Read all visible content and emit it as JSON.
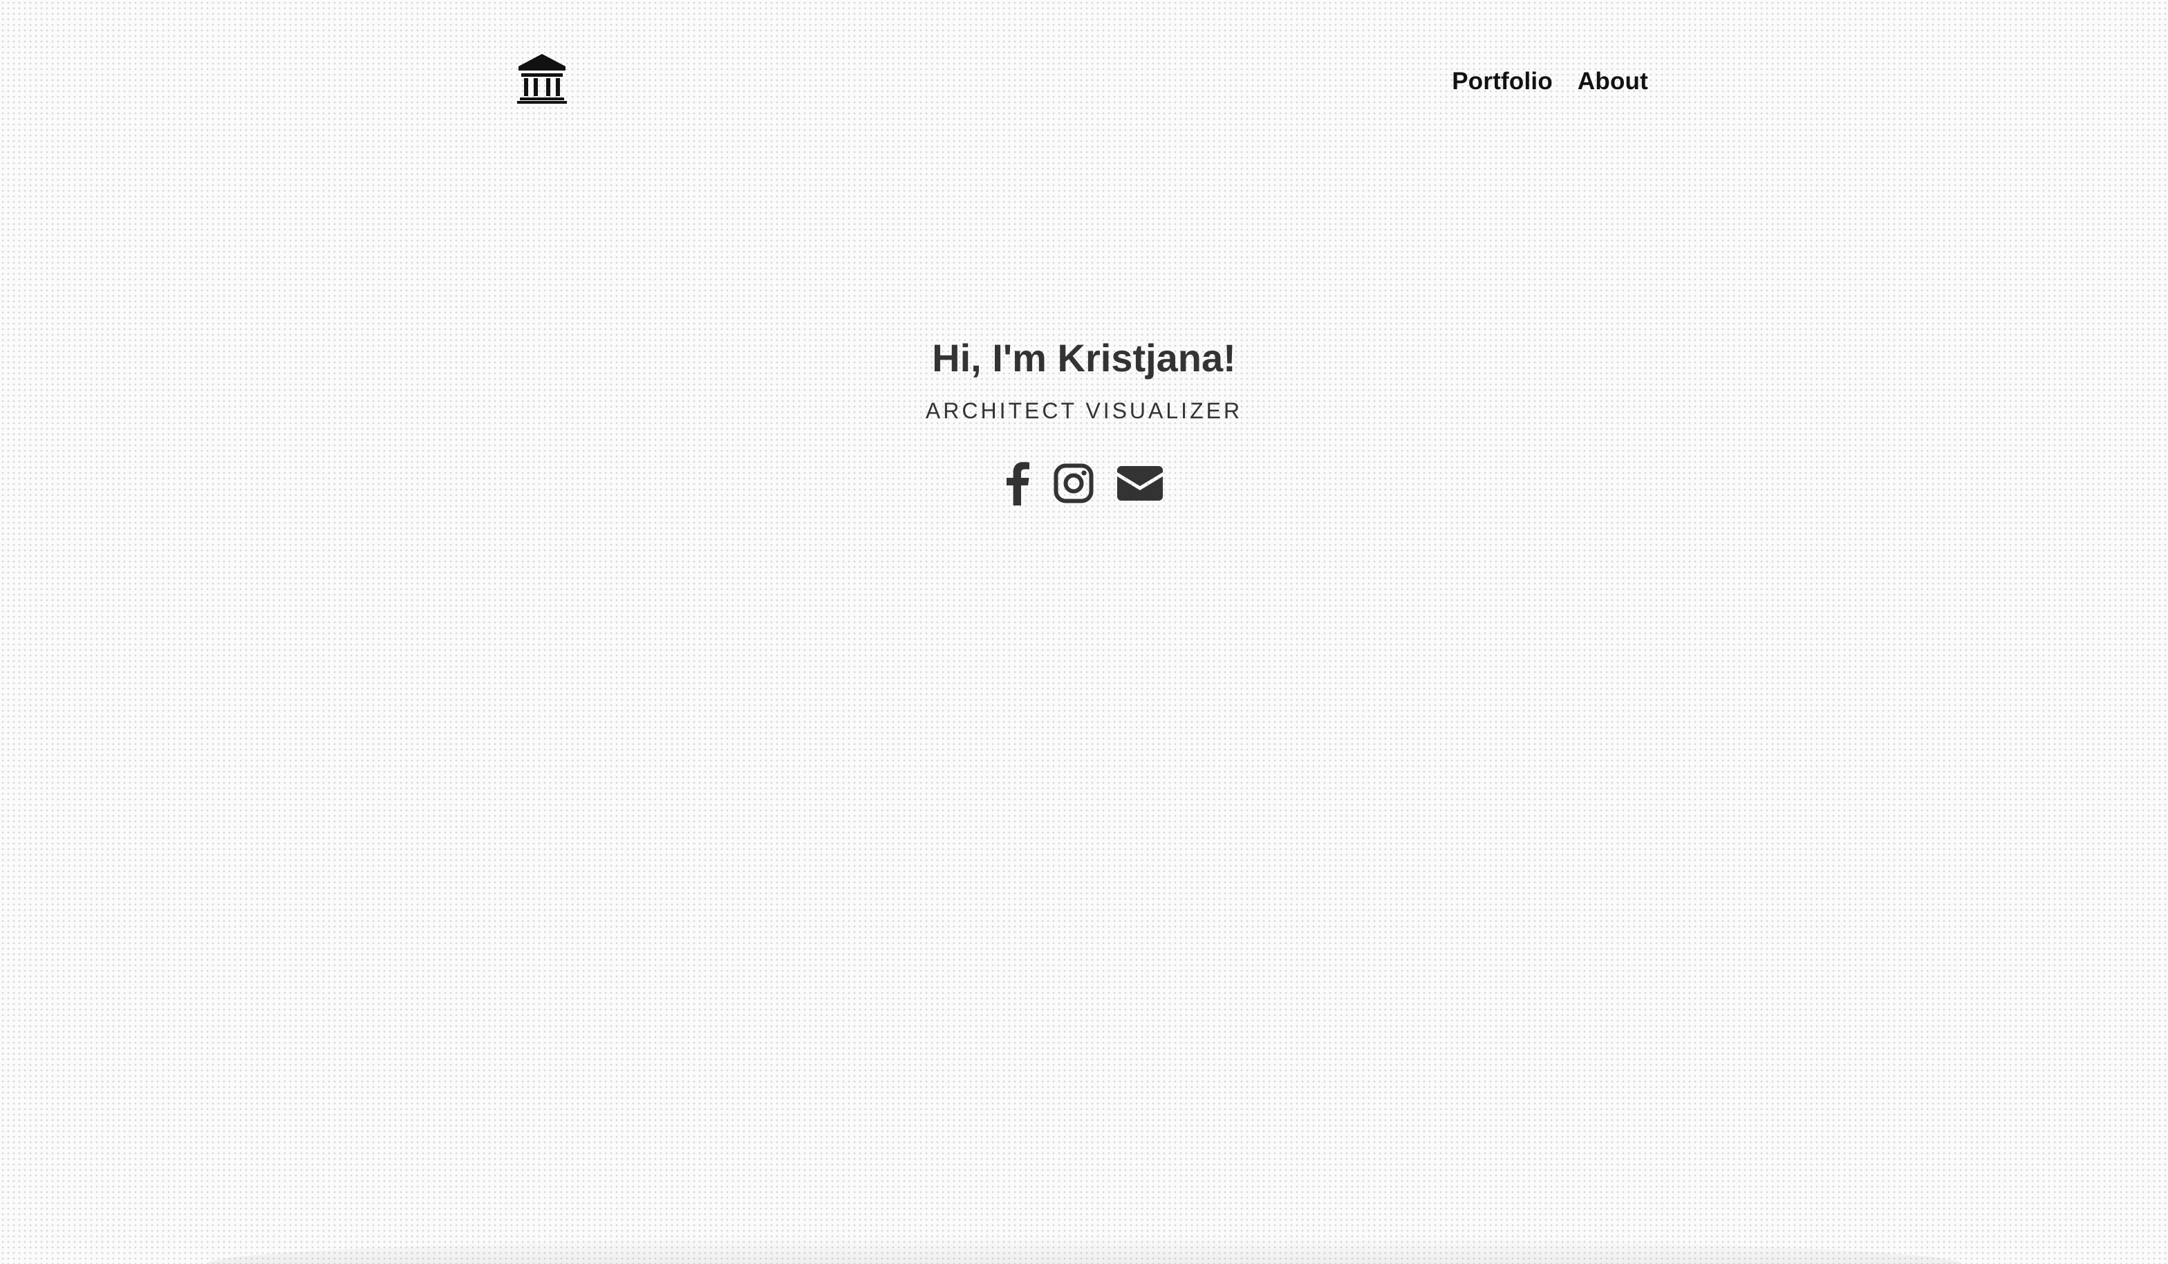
{
  "header": {
    "logo_icon": "building-columns-icon",
    "nav": [
      {
        "label": "Portfolio"
      },
      {
        "label": "About"
      }
    ]
  },
  "hero": {
    "title": "Hi, I'm Kristjana!",
    "subtitle": "ARCHITECT VISUALIZER"
  },
  "social_links": [
    {
      "icon": "facebook-icon"
    },
    {
      "icon": "instagram-icon"
    },
    {
      "icon": "envelope-icon"
    }
  ],
  "colors": {
    "text": "#333333",
    "nav_text": "#111111",
    "background": "#fbfbfb",
    "icon": "#333333"
  }
}
